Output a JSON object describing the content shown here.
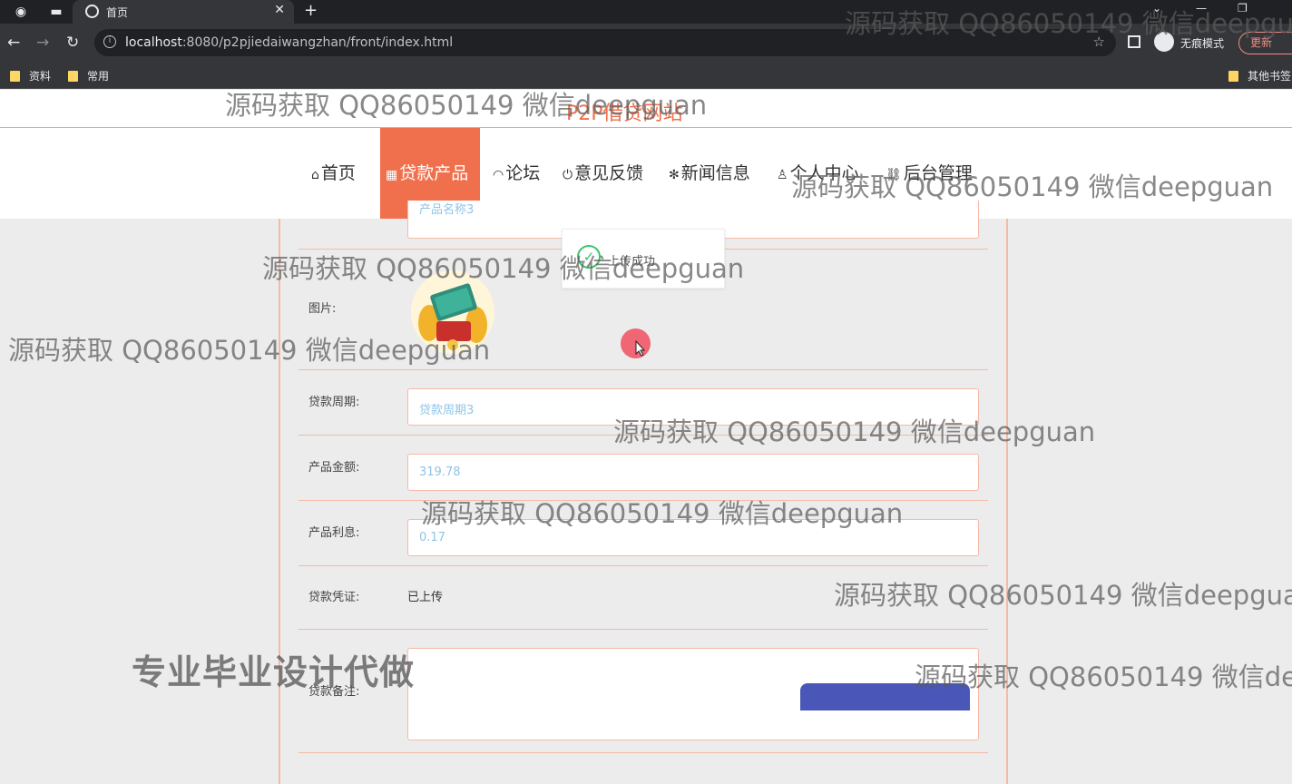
{
  "browser": {
    "tab_title": "首页",
    "url_host": "localhost",
    "url_rest": ":8080/p2pjiedaiwangzhan/front/index.html",
    "incognito_label": "无痕模式",
    "update_label": "更新",
    "bookmarks": [
      "资料",
      "常用"
    ],
    "other_bookmarks": "其他书签"
  },
  "site": {
    "title": "P2P借贷网站",
    "nav": [
      {
        "icon": "home-icon",
        "label": "首页"
      },
      {
        "icon": "product-icon",
        "label": "贷款产品"
      },
      {
        "icon": "forum-icon",
        "label": "论坛"
      },
      {
        "icon": "feedback-icon",
        "label": "意见反馈"
      },
      {
        "icon": "news-icon",
        "label": "新闻信息"
      },
      {
        "icon": "user-icon",
        "label": "个人中心"
      },
      {
        "icon": "link-icon",
        "label": "后台管理"
      }
    ],
    "active_nav": "贷款产品"
  },
  "form": {
    "product_name_placeholder": "产品名称3",
    "image_label": "图片:",
    "period_label": "贷款周期:",
    "period_value": "贷款周期3",
    "amount_label": "产品金额:",
    "amount_value": "319.78",
    "interest_label": "产品利息:",
    "interest_value": "0.17",
    "voucher_label": "贷款凭证:",
    "voucher_value": "已上传",
    "remark_label": "贷款备注:"
  },
  "toast": {
    "message": "上传成功"
  },
  "watermarks": {
    "qq": "源码获取 QQ86050149 微信deepguan",
    "promo": "专业毕业设计代做"
  },
  "colors": {
    "accent": "#f06f4c",
    "border": "#f6b9a7",
    "button": "#4a57b8"
  }
}
